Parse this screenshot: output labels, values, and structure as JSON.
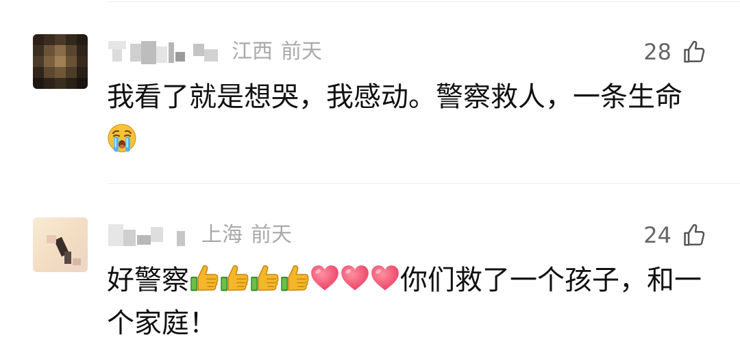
{
  "comments": [
    {
      "region": "江西",
      "time": "前天",
      "likes": "28",
      "text_before": "我看了就是想哭，我感动。警察救人，一条生命",
      "emojis": [
        "crying-face-icon"
      ],
      "text_after": ""
    },
    {
      "region": "上海",
      "time": "前天",
      "likes": "24",
      "text_before": "好警察",
      "emojis": [
        "thumbs-up-icon",
        "thumbs-up-icon",
        "thumbs-up-icon",
        "thumbs-up-icon",
        "heart-icon",
        "heart-icon",
        "heart-icon"
      ],
      "text_after": "你们救了一个孩子，和一个家庭！"
    }
  ],
  "colors": {
    "meta": "#a9a9a9",
    "text": "#111111",
    "divider": "#eeeeee",
    "like": "#666666"
  }
}
